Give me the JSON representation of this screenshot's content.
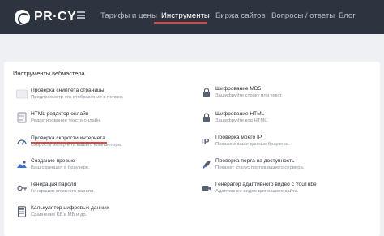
{
  "header": {
    "logo_text": "PR·CY",
    "nav": [
      {
        "label": "Тарифы и цены"
      },
      {
        "label": "Инструменты"
      },
      {
        "label": "Биржа сайтов"
      },
      {
        "label": "Вопросы / ответы"
      },
      {
        "label": "Блог"
      }
    ]
  },
  "section": {
    "title": "Инструменты вебмастера"
  },
  "tools_left": [
    {
      "name": "Проверка сниппета страницы",
      "desc": "Предпросмотр его отображения в поиске."
    },
    {
      "name": "HTML редактор онлайн",
      "desc": "Редактирование текста онлайн."
    },
    {
      "name": "Проверка скорости интернета",
      "desc": "Скорость интернета вашего компьютера."
    },
    {
      "name": "Создание превью",
      "desc": "Ваш скриншот в браузере."
    },
    {
      "name": "Генерация пароля",
      "desc": "Генерация сложного пароля."
    },
    {
      "name": "Калькулятор цифровых данных",
      "desc": "Сравнение КБ в МБ и др."
    }
  ],
  "tools_right": [
    {
      "name": "Шифрование MD5",
      "desc": "Зашифруйте строку или текст."
    },
    {
      "name": "Шифрование HTML",
      "desc": "Зашифруйте код HTML."
    },
    {
      "name": "Проверка моего IP",
      "desc": "Покажем ваше данные браузера."
    },
    {
      "name": "Проверка порта на доступность",
      "desc": "Покажет статус портов вашего сервера."
    },
    {
      "name": "Генератор адаптивного видео с YouTube",
      "desc": "Адаптивное видео для вашего сайта."
    }
  ],
  "icons": {
    "snippet": "snippet-icon",
    "html_editor": "code-icon",
    "speed": "speedometer-icon",
    "preview": "image-icon",
    "password": "key-icon",
    "calculator": "calculator-icon",
    "md5": "lock-icon",
    "html_encrypt": "lock-icon",
    "ip": "ip-icon",
    "port": "rocket-icon",
    "video": "video-icon"
  },
  "colors": {
    "header_bg": "#2e3340",
    "accent_red": "#e0443d",
    "page_bg": "#eef0f3",
    "card_bg": "#ffffff"
  }
}
